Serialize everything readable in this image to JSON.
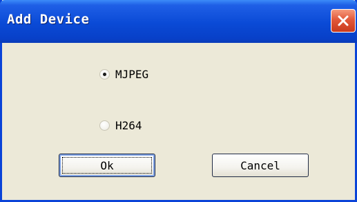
{
  "window": {
    "title": "Add Device"
  },
  "title_bar": {
    "close_icon": "close-icon"
  },
  "options": [
    {
      "label": "MJPEG",
      "checked": true
    },
    {
      "label": "H264",
      "checked": false
    }
  ],
  "buttons": {
    "ok_label": "Ok",
    "cancel_label": "Cancel"
  },
  "colors": {
    "title_bar": "#0a4ad6",
    "dialog_bg": "#ece9d8",
    "close_button": "#e2583a"
  }
}
